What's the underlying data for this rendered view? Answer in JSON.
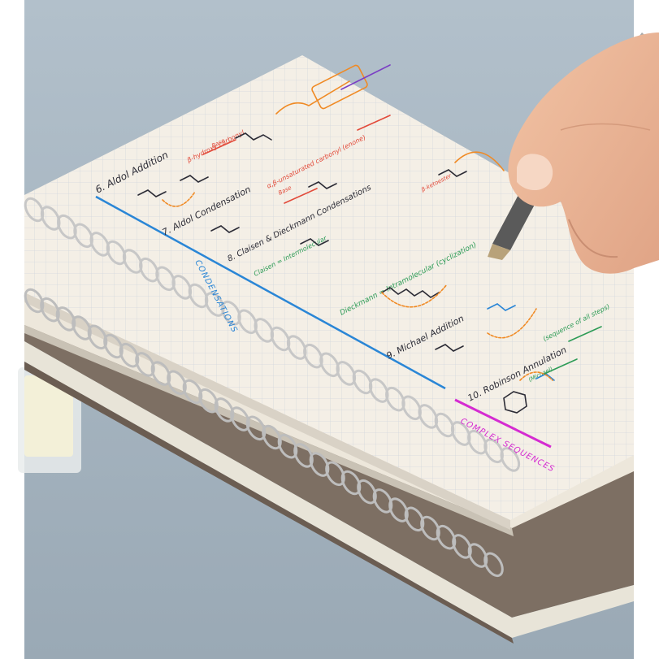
{
  "colors": {
    "desk": "#a9b8c4",
    "paper": "#f4efe6",
    "grid": "#d6d9df",
    "ring": "#cfcfcf",
    "cover_brown": "#7d6f63",
    "blue": "#2a86d6",
    "magenta": "#d52bd1",
    "red": "#e24a3a",
    "orange": "#f08a24",
    "green": "#2d9b56",
    "purple": "#7b3fc4",
    "dark": "#2c2c36"
  },
  "notes": {
    "aldol_addition": "6. Aldol Addition",
    "aldol_condensation": "7. Aldol Condensation",
    "claisen": "8. Claisen & Dieckmann Condensations",
    "michael": "9. Michael Addition",
    "robinson": "10. Robinson Annulation",
    "beta_hydroxy": "β-hydroxy carbonyl",
    "unsaturated": "α,β-unsaturated carbonyl (enone)",
    "ketoester": "β-ketoester",
    "claisen_inter": "Claisen = Intermolecular",
    "dieckmann_intra": "Dieckmann = Intramolecular (cyclization)",
    "robinson_note": "(sequence of all steps)",
    "base": "Base",
    "michael_label": "(Michael)",
    "condensations_header": "CONDENSATIONS",
    "complex_header": "COMPLEX SEQUENCES"
  }
}
